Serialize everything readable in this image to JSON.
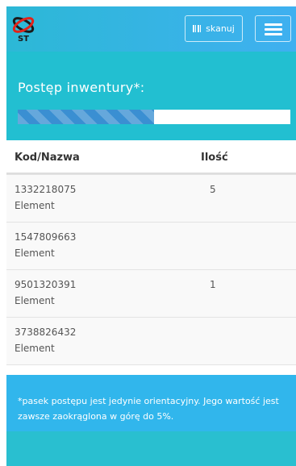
{
  "header": {
    "logo_text": "ST",
    "scan_button_label": "skanuj",
    "colors": {
      "navbar": "#2cb8d6",
      "accent": "#e2231a"
    }
  },
  "progress": {
    "title": "Postęp inwentury*:",
    "value_percent": 50
  },
  "table": {
    "columns": [
      "Kod/Nazwa",
      "Ilość"
    ],
    "rows": [
      {
        "code": "1332218075",
        "name": "Element",
        "qty": "5"
      },
      {
        "code": "1547809663",
        "name": "Element",
        "qty": ""
      },
      {
        "code": "9501320391",
        "name": "Element",
        "qty": "1"
      },
      {
        "code": "3738826432",
        "name": "Element",
        "qty": ""
      }
    ]
  },
  "footer": {
    "note": "*pasek postępu jest jedynie orientacyjny. Jego wartość jest zawsze zaokrąglona w górę do 5%."
  }
}
